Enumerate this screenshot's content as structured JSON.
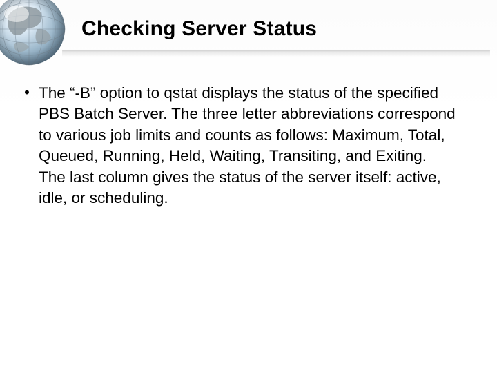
{
  "slide": {
    "title": "Checking Server Status",
    "bullets": [
      "The “-B” option to qstat displays the status of the specified PBS Batch Server. The three letter abbreviations correspond to various job limits and counts as follows: Maximum, Total, Queued, Running, Held, Waiting, Transiting, and Exiting. The last column gives  the status of the server itself: active, idle, or scheduling."
    ]
  }
}
